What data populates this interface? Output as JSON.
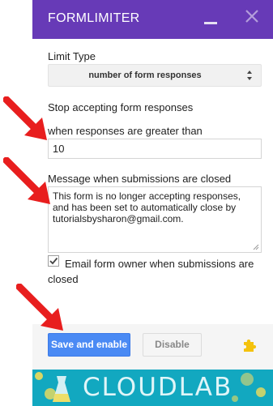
{
  "app": {
    "title": "FORMLIMITER"
  },
  "limit_type": {
    "label": "Limit Type",
    "selected": "number of form responses"
  },
  "stop_section": {
    "heading": "Stop accepting form responses",
    "threshold_label": "when responses are greater than",
    "threshold_value": "10"
  },
  "message": {
    "label": "Message when submissions are closed",
    "value": "This form is no longer accepting responses, and has been set to automatically close by tutorialsbysharon@gmail.com."
  },
  "email_owner": {
    "checked": true,
    "label": "Email form owner when submissions are closed"
  },
  "footer": {
    "save_label": "Save and enable",
    "disable_label": "Disable"
  },
  "banner": {
    "text": "CLOUDLAB"
  },
  "colors": {
    "header": "#673ab7",
    "primary_button": "#4a8af4",
    "banner": "#12a8c0",
    "annotation_arrow": "#e81e1e",
    "puzzle_icon": "#f4c20d"
  },
  "icons": [
    "minimize-icon",
    "close-icon",
    "select-arrows-icon",
    "checkmark-icon",
    "resize-grip-icon",
    "puzzle-icon",
    "annotation-arrow-icon"
  ]
}
